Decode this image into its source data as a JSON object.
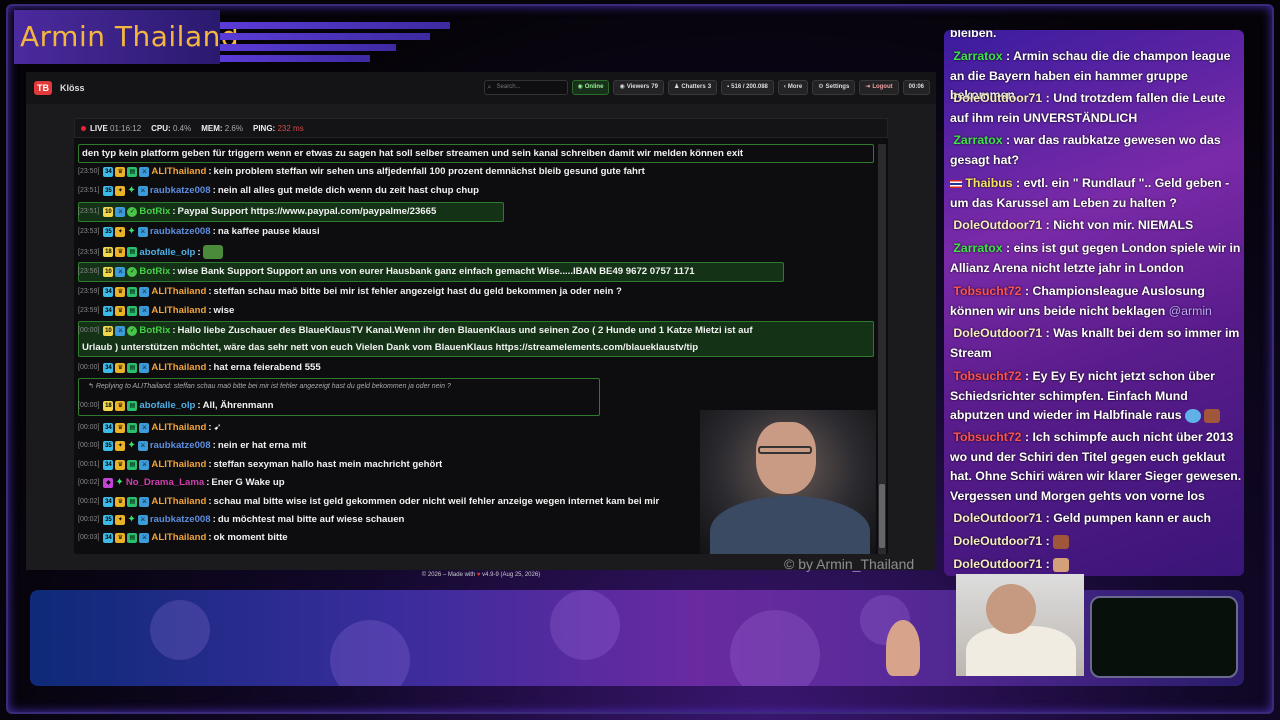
{
  "overlay": {
    "title": "Armin Thailand",
    "watermark": "© by Armin_Thailand"
  },
  "browser": {
    "app_name": "Klöss",
    "logo_text": "TB",
    "search_placeholder": "Search...",
    "buttons": {
      "online": "Online",
      "viewers": "Viewers",
      "viewers_count": "79",
      "chatters": "Chatters",
      "chatters_count": "3",
      "messages": "516 / 200.088",
      "more": "More",
      "settings": "Settings",
      "logout": "Logout",
      "timer": "00:06"
    },
    "status": {
      "live_label": "LIVE",
      "live_time": "01:16:12",
      "cpu_label": "CPU:",
      "cpu_value": "0.4%",
      "mem_label": "MEM:",
      "mem_value": "2.6%",
      "ping_label": "PING:",
      "ping_value": "232 ms"
    },
    "footer": {
      "left": "© 2026 – Made with",
      "right": "v4.9-9 (Aug 25, 2026)"
    }
  },
  "chat": {
    "top_line": "den typ kein platform geben für triggern wenn er etwas zu sagen hat soll selber streamen und sein kanal schreiben damit wir melden können exit",
    "messages": [
      {
        "ts": "[23:50]",
        "user": "ALIThailand",
        "text": "kein problem steffan wir sehen uns alfjedenfall 100 prozent demnächst bleib gesund gute fahrt"
      },
      {
        "ts": "[23:51]",
        "user": "raubkatze008",
        "text": "nein all alles gut melde dich wenn du zeit hast chup chup"
      },
      {
        "ts": "[23:51]",
        "user": "BotRix",
        "text": "Paypal Support https://www.paypal.com/paypalme/23665"
      },
      {
        "ts": "[23:53]",
        "user": "raubkatze008",
        "text": "na kaffee pause klausi"
      },
      {
        "ts": "[23:53]",
        "user": "abofalle_olp",
        "text": ""
      },
      {
        "ts": "[23:56]",
        "user": "BotRix",
        "text": "wise Bank Support Support an uns von eurer Hausbank ganz einfach gemacht Wise.....IBAN BE49 9672 0757 1171"
      },
      {
        "ts": "[23:59]",
        "user": "ALIThailand",
        "text": "steffan schau maö bitte bei mir ist fehler angezeigt hast du geld bekommen ja oder nein ?"
      },
      {
        "ts": "[23:59]",
        "user": "ALIThailand",
        "text": "wise"
      },
      {
        "ts": "[00:00]",
        "user": "BotRix",
        "text": "Hallo liebe Zuschauer des BlaueKlausTV Kanal.Wenn ihr den BlauenKlaus und seinen Zoo ( 2 Hunde und 1 Katze Mietzi ist auf",
        "text2": "Urlaub ) unterstützen möchtet, wäre das sehr nett von euch Vielen Dank vom BlauenKlaus https://streamelements.com/blaueklaustv/tip"
      },
      {
        "ts": "[00:00]",
        "user": "ALIThailand",
        "text": "hat erna feierabend 555"
      },
      {
        "reply": "Replying to ALIThailand: steffan schau maö bitte bei mir ist fehler angezeigt hast du geld bekommen ja oder nein ?"
      },
      {
        "ts": "[00:00]",
        "user": "abofalle_olp",
        "text": "All, Ährenmann"
      },
      {
        "ts": "[00:00]",
        "user": "ALIThailand",
        "text": ""
      },
      {
        "ts": "[00:00]",
        "user": "raubkatze008",
        "text": "nein er hat erna mit"
      },
      {
        "ts": "[00:01]",
        "user": "ALIThailand",
        "text": "steffan sexyman hallo hast mein machricht gehört"
      },
      {
        "ts": "[00:02]",
        "user": "No_Drama_Lama",
        "text": "Ener G Wake up"
      },
      {
        "ts": "[00:02]",
        "user": "ALIThailand",
        "text": "schau mal bitte wise ist geld gekommen oder nicht weil fehler anzeige wegen internet kam bei mir"
      },
      {
        "ts": "[00:02]",
        "user": "raubkatze008",
        "text": "du möchtest mal bitte auf wiese schauen"
      },
      {
        "ts": "[00:03]",
        "user": "ALIThailand",
        "text": "ok moment bitte"
      }
    ]
  },
  "side_chat": {
    "top_fragment": "bleiben.",
    "messages": [
      {
        "user": "Zarratox",
        "text": "Armin schau die die champon league an die Bayern haben ein hammer gruppe bekommen"
      },
      {
        "user": "DoleOutdoor71",
        "text": "Und trotzdem fallen die Leute auf ihm rein UNVERSTÄNDLICH"
      },
      {
        "user": "Zarratox",
        "text": "war das raubkatze gewesen wo das gesagt hat?"
      },
      {
        "user": "Thaibus",
        "text": "evtl. ein \" Rundlauf \".. Geld geben - um das Karussel am Leben zu halten ?"
      },
      {
        "user": "DoleOutdoor71",
        "text": "Nicht von mir. NIEMALS"
      },
      {
        "user": "Zarratox",
        "text": "eins ist gut gegen London spiele wir in Allianz Arena nicht letzte jahr in London"
      },
      {
        "user": "Tobsucht72",
        "text": "Championsleague Auslosung können wir uns beide nicht beklagen",
        "mention": "@armin"
      },
      {
        "user": "DoleOutdoor71",
        "text": "Was knallt bei dem so immer im Stream"
      },
      {
        "user": "Tobsucht72",
        "text": "Ey Ey Ey nicht jetzt schon über Schiedsrichter schimpfen. Einfach Mund abputzen und wieder im Halbfinale raus"
      },
      {
        "user": "Tobsucht72",
        "text": "Ich schimpfe auch nicht über 2013 wo und der Schiri den Titel gegen euch geklaut hat. Ohne Schiri wären wir klarer Sieger gewesen. Vergessen und Morgen gehts von vorne los"
      },
      {
        "user": "DoleOutdoor71",
        "text": "Geld pumpen kann er auch"
      },
      {
        "user": "DoleOutdoor71",
        "text": ""
      },
      {
        "user": "DoleOutdoor71",
        "text": ""
      }
    ]
  },
  "colors": {
    "title_accent": "#f5b640",
    "online_green": "#9cf19c",
    "ping_red": "#d24c4c",
    "side_green": "#41e24b",
    "side_cream": "#f6ecc0",
    "side_red": "#ff5252"
  }
}
